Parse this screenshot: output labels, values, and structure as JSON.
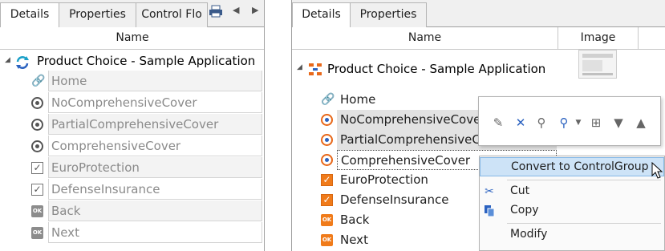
{
  "left": {
    "tabs": [
      {
        "label": "Details"
      },
      {
        "label": "Properties"
      },
      {
        "label": "Control Flo"
      }
    ],
    "column_name": "Name",
    "root": {
      "label": "Product Choice - Sample Application"
    },
    "items": [
      {
        "label": "Home",
        "icon": "link-icon"
      },
      {
        "label": "NoComprehensiveCover",
        "icon": "radio-icon"
      },
      {
        "label": "PartialComprehensiveCover",
        "icon": "radio-icon"
      },
      {
        "label": "ComprehensiveCover",
        "icon": "radio-icon"
      },
      {
        "label": "EuroProtection",
        "icon": "checkbox-icon"
      },
      {
        "label": "DefenseInsurance",
        "icon": "checkbox-icon"
      },
      {
        "label": "Back",
        "icon": "ok-button-icon"
      },
      {
        "label": "Next",
        "icon": "ok-button-icon"
      }
    ]
  },
  "right": {
    "tabs": [
      {
        "label": "Details"
      },
      {
        "label": "Properties"
      }
    ],
    "column_name": "Name",
    "column_image": "Image",
    "root": {
      "label": "Product Choice - Sample Application"
    },
    "items": [
      {
        "label": "Home",
        "icon": "link-icon"
      },
      {
        "label": "NoComprehensiveCover",
        "icon": "radio-icon"
      },
      {
        "label": "PartialComprehensiveCover",
        "icon": "radio-icon"
      },
      {
        "label": "ComprehensiveCover",
        "icon": "radio-icon"
      },
      {
        "label": "EuroProtection",
        "icon": "checkbox-icon"
      },
      {
        "label": "DefenseInsurance",
        "icon": "checkbox-icon"
      },
      {
        "label": "Back",
        "icon": "ok-button-icon"
      },
      {
        "label": "Next",
        "icon": "ok-button-icon"
      }
    ]
  },
  "context_menu": {
    "items": [
      {
        "label": "Convert to ControlGroup",
        "icon": ""
      },
      {
        "label": "Cut",
        "icon": "scissors-icon"
      },
      {
        "label": "Copy",
        "icon": "copy-icon"
      },
      {
        "label": "Modify",
        "icon": ""
      }
    ]
  },
  "colors": {
    "accent_orange": "#f07b1a",
    "accent_blue": "#2b62c0",
    "highlight": "#cde3f7"
  }
}
